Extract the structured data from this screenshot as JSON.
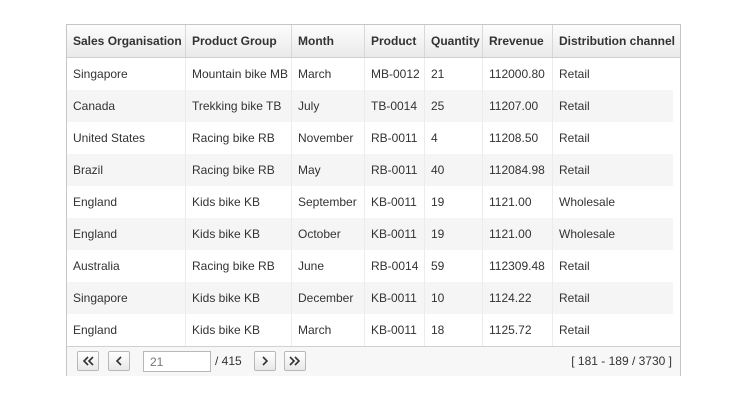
{
  "columns": [
    {
      "label": "Sales Organisation"
    },
    {
      "label": "Product Group"
    },
    {
      "label": "Month"
    },
    {
      "label": "Product"
    },
    {
      "label": "Quantity"
    },
    {
      "label": "Rrevenue"
    },
    {
      "label": "Distribution channel"
    }
  ],
  "rows": [
    [
      "Singapore",
      "Mountain bike MB",
      "March",
      "MB-0012",
      "21",
      "112000.80",
      "Retail"
    ],
    [
      "Canada",
      "Trekking bike TB",
      "July",
      "TB-0014",
      "25",
      "11207.00",
      "Retail"
    ],
    [
      "United States",
      "Racing bike RB",
      "November",
      "RB-0011",
      "4",
      "11208.50",
      "Retail"
    ],
    [
      "Brazil",
      "Racing bike RB",
      "May",
      "RB-0011",
      "40",
      "112084.98",
      "Retail"
    ],
    [
      "England",
      "Kids bike KB",
      "September",
      "KB-0011",
      "19",
      "1121.00",
      "Wholesale"
    ],
    [
      "England",
      "Kids bike KB",
      "October",
      "KB-0011",
      "19",
      "1121.00",
      "Wholesale"
    ],
    [
      "Australia",
      "Racing bike RB",
      "June",
      "RB-0014",
      "59",
      "112309.48",
      "Retail"
    ],
    [
      "Singapore",
      "Kids bike KB",
      "December",
      "KB-0011",
      "10",
      "1124.22",
      "Retail"
    ],
    [
      "England",
      "Kids bike KB",
      "March",
      "KB-0011",
      "18",
      "1125.72",
      "Retail"
    ]
  ],
  "pager": {
    "first_icon": "double-chevron-left-icon",
    "prev_icon": "chevron-left-icon",
    "next_icon": "chevron-right-icon",
    "last_icon": "double-chevron-right-icon",
    "page_placeholder": "21",
    "total_pages": "/ 415",
    "range": "[ 181 - 189 / 3730 ]"
  }
}
